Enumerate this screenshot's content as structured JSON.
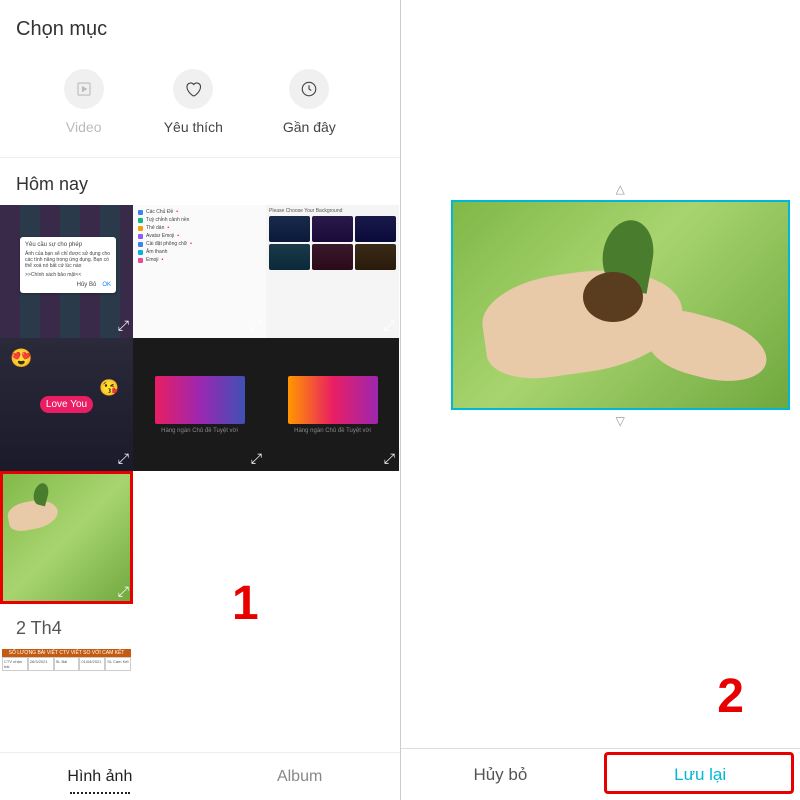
{
  "left": {
    "title": "Chọn mục",
    "categories": {
      "video": "Video",
      "favorite": "Yêu thích",
      "recent": "Gần đây"
    },
    "section_today": "Hôm nay",
    "app_rows": [
      "Các Chủ Đề",
      "Tuỳ chỉnh cảnh nền",
      "Thẻ dán",
      "Avatar Emoji",
      "Cài đặt phông chữ",
      "Âm thanh",
      "Emoji"
    ],
    "kb_label": "Please Choose Your Background",
    "modal": {
      "title": "Yêu cầu sự cho phép",
      "body": "Ảnh của bạn sẽ chỉ được sử dụng cho các tính năng trong ứng dụng. Bạn có thể xoá nó bất cứ lúc nào",
      "policy": ">>Chính sách bảo mật<<",
      "cancel": "Hủy Bỏ",
      "ok": "OK"
    },
    "keyboard_caption": "Hàng ngàn Chủ đề Tuyệt vời",
    "date_section": "2 Th4",
    "excel_header": "SỐ LƯỢNG BÀI VIẾT CTV VIẾT SO VỚI CAM KẾT",
    "tabs": {
      "images": "Hình ảnh",
      "album": "Album"
    },
    "step": "1"
  },
  "right": {
    "step": "2",
    "cancel": "Hủy bỏ",
    "save": "Lưu lại"
  }
}
